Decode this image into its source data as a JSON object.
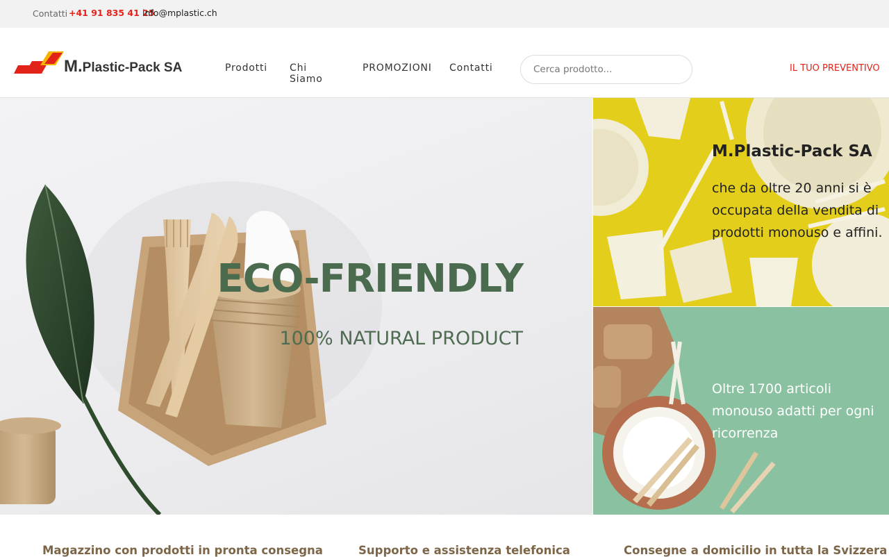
{
  "topbar": {
    "contacts_label": "Contatti",
    "phone": "+41 91 835 41 25",
    "email": "info@mplastic.ch"
  },
  "header": {
    "logo_text_big": "M.",
    "logo_text_small": "Plastic-Pack SA",
    "nav": [
      "Prodotti",
      "Chi Siamo",
      "PROMOZIONI",
      "Contatti"
    ],
    "search_placeholder": "Cerca prodotto...",
    "quote_link": "IL TUO PREVENTIVO"
  },
  "hero": {
    "title": "ECO-FRIENDLY",
    "subtitle": "100% NATURAL PRODUCT"
  },
  "panels": {
    "yellow": {
      "title": "M.Plastic-Pack SA",
      "text": "che da oltre 20 anni si è occupata della vendita di prodotti monouso e affini."
    },
    "green": {
      "text": "Oltre 1700 articoli monouso adatti per ogni ricorrenza"
    }
  },
  "features": [
    "Magazzino con prodotti in pronta consegna",
    "Supporto e assistenza telefonica",
    "Consegne a domicilio in tutta la Svizzera"
  ],
  "colors": {
    "brand_red": "#e2231a",
    "hero_green": "#4b6b4f",
    "panel_yellow": "#e3cf1b",
    "panel_green": "#8ac1a0",
    "feature_brown": "#7d6648"
  }
}
